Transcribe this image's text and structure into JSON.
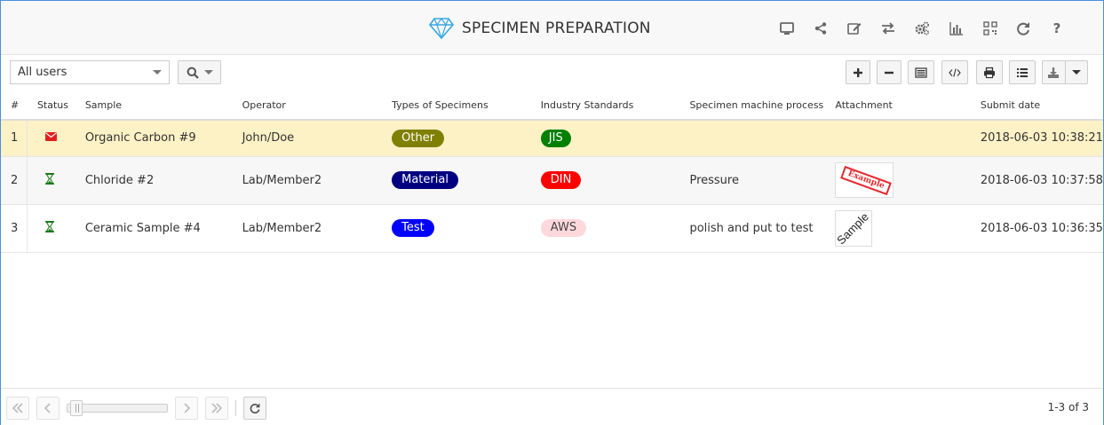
{
  "header": {
    "title": "SPECIMEN PREPARATION",
    "title_icon": "diamond-icon",
    "tools": [
      {
        "name": "desktop-icon"
      },
      {
        "name": "share-icon"
      },
      {
        "name": "edit-icon"
      },
      {
        "name": "transfer-icon"
      },
      {
        "name": "gears-icon"
      },
      {
        "name": "bar-chart-icon"
      },
      {
        "name": "qr-code-icon"
      },
      {
        "name": "refresh-icon"
      },
      {
        "name": "help-icon"
      }
    ]
  },
  "toolbar": {
    "user_filter": "All users",
    "search_icon": "search-icon",
    "buttons": [
      "plus-icon",
      "minus-icon",
      "columns-icon",
      "code-icon",
      "print-icon",
      "list-icon"
    ],
    "export_icon": "download-icon"
  },
  "table": {
    "columns": [
      "#",
      "Status",
      "Sample",
      "Operator",
      "Types of Specimens",
      "Industry Standards",
      "Specimen machine process",
      "Attachment",
      "Submit date"
    ],
    "rows": [
      {
        "num": "1",
        "status_icon": "envelope-icon",
        "sample": "Organic Carbon #9",
        "operator": "John/Doe",
        "type": "Other",
        "type_color": "#808000",
        "standard": "JIS",
        "standard_bg": "#008000",
        "standard_fg": "#ffffff",
        "process": "",
        "attachment": "",
        "date": "2018-06-03 10:38:21"
      },
      {
        "num": "2",
        "status_icon": "hourglass-icon",
        "sample": "Chloride #2",
        "operator": "Lab/Member2",
        "type": "Material",
        "type_color": "#000080",
        "standard": "DIN",
        "standard_bg": "#ff0000",
        "standard_fg": "#ffffff",
        "process": "Pressure",
        "attachment": "Example",
        "date": "2018-06-03 10:37:58"
      },
      {
        "num": "3",
        "status_icon": "hourglass-icon",
        "sample": "Ceramic Sample #4",
        "operator": "Lab/Member2",
        "type": "Test",
        "type_color": "#0000ff",
        "standard": "AWS",
        "standard_bg": "#ffd8dc",
        "standard_fg": "#444444",
        "process": "polish and put to test",
        "attachment": "Sample",
        "date": "2018-06-03 10:36:35"
      }
    ]
  },
  "footer": {
    "page_info": "1-3 of 3"
  },
  "colors": {
    "highlight_row": "#fdf1c6",
    "frame_border": "#4a90d9",
    "diamond": "#38a8e0"
  }
}
